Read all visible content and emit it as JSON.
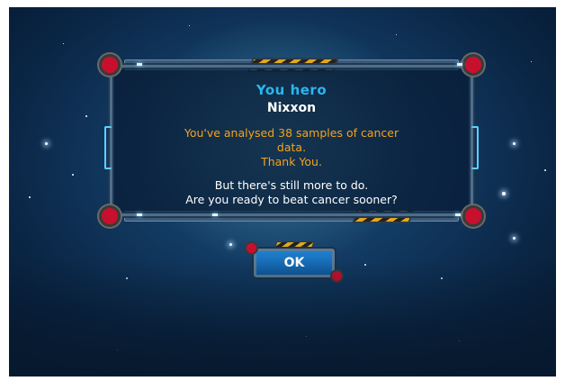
{
  "dialog": {
    "title": "You hero",
    "player_name": "Nixxon",
    "message_line1": "You've analysed 38 samples of cancer",
    "message_line2": "data.",
    "message_line3": "Thank You.",
    "prompt_line1": "But there's still more to do.",
    "prompt_line2": "Are you ready to beat cancer sooner?"
  },
  "buttons": {
    "ok_label": "OK"
  },
  "colors": {
    "title": "#2bb6ee",
    "message": "#f5a31a",
    "prompt": "#ffffff",
    "button": "#1f7fcf",
    "background": "#123a62"
  }
}
